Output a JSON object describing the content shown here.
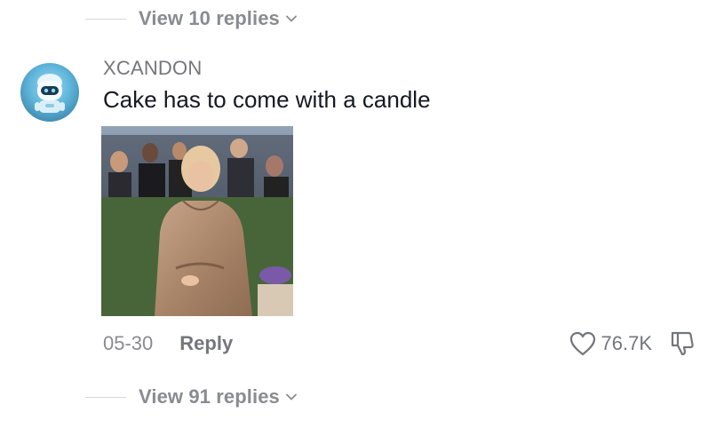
{
  "thread": {
    "top_replies_label": "View 10 replies",
    "bottom_replies_label": "View 91 replies"
  },
  "comment": {
    "username": "XCANDON",
    "text": "Cake has to come with a candle",
    "date": "05-30",
    "reply_label": "Reply",
    "like_count": "76.7K",
    "avatar_icon": "robot-avatar-icon",
    "attachment_icon": "gif-sticker-image"
  },
  "icons": {
    "like": "heart-icon",
    "dislike": "thumbs-down-icon",
    "expand": "chevron-down-icon"
  },
  "colors": {
    "text_primary": "#161823",
    "text_secondary": "#75767c",
    "text_muted": "#8a8b91"
  }
}
